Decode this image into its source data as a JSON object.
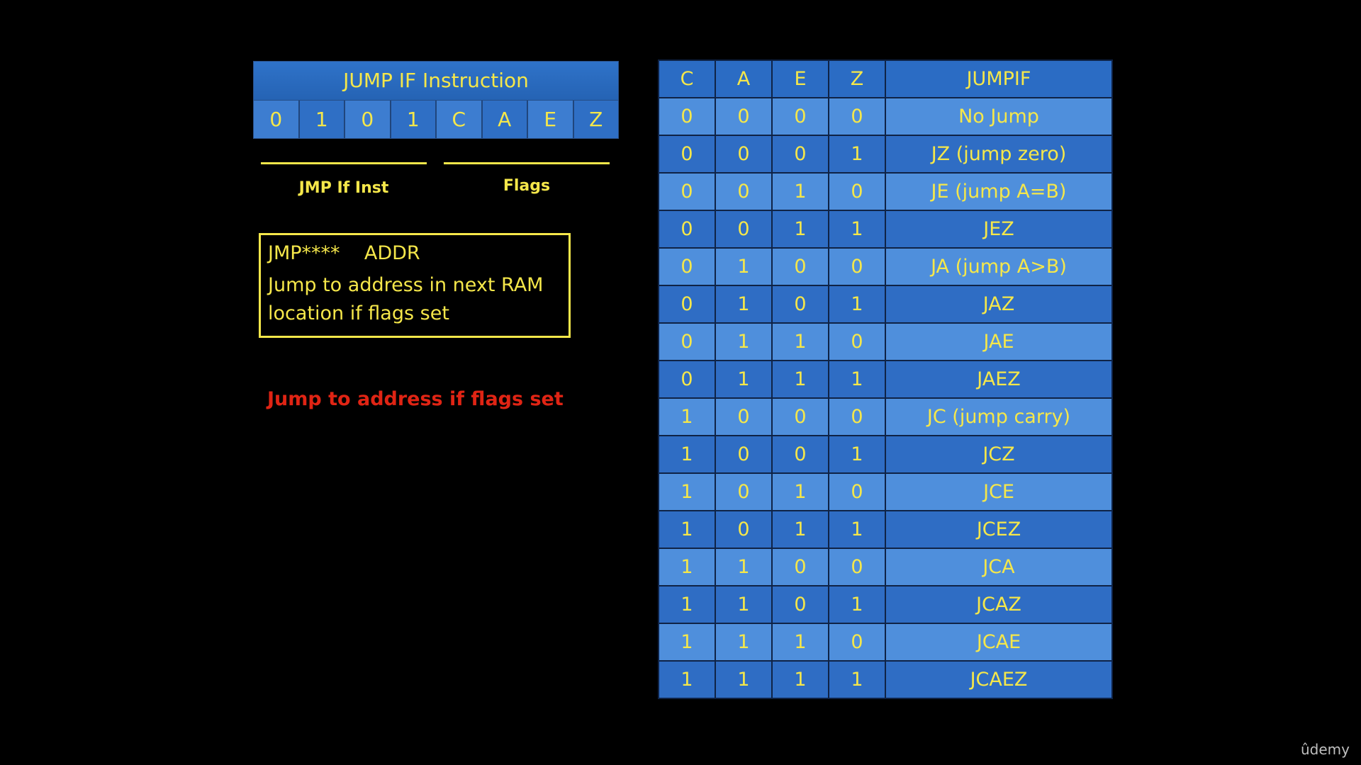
{
  "instruction": {
    "header": "JUMP  IF Instruction",
    "bits": [
      "0",
      "1",
      "0",
      "1",
      "C",
      "A",
      "E",
      "Z"
    ],
    "left_label": "JMP If Inst",
    "right_label": "Flags"
  },
  "syntax": {
    "line1": "JMP****    ADDR",
    "line2": "Jump  to address in next RAM",
    "line3": "location if flags set"
  },
  "note": "Jump  to address if flags set",
  "table": {
    "headers": [
      "C",
      "A",
      "E",
      "Z",
      "JUMPIF"
    ],
    "rows": [
      [
        "0",
        "0",
        "0",
        "0",
        "No Jump"
      ],
      [
        "0",
        "0",
        "0",
        "1",
        "JZ (jump zero)"
      ],
      [
        "0",
        "0",
        "1",
        "0",
        "JE (jump A=B)"
      ],
      [
        "0",
        "0",
        "1",
        "1",
        "JEZ"
      ],
      [
        "0",
        "1",
        "0",
        "0",
        "JA (jump A>B)"
      ],
      [
        "0",
        "1",
        "0",
        "1",
        "JAZ"
      ],
      [
        "0",
        "1",
        "1",
        "0",
        "JAE"
      ],
      [
        "0",
        "1",
        "1",
        "1",
        "JAEZ"
      ],
      [
        "1",
        "0",
        "0",
        "0",
        "JC (jump carry)"
      ],
      [
        "1",
        "0",
        "0",
        "1",
        "JCZ"
      ],
      [
        "1",
        "0",
        "1",
        "0",
        "JCE"
      ],
      [
        "1",
        "0",
        "1",
        "1",
        "JCEZ"
      ],
      [
        "1",
        "1",
        "0",
        "0",
        "JCA"
      ],
      [
        "1",
        "1",
        "0",
        "1",
        "JCAZ"
      ],
      [
        "1",
        "1",
        "1",
        "0",
        "JCAE"
      ],
      [
        "1",
        "1",
        "1",
        "1",
        "JCAEZ"
      ]
    ]
  },
  "brand": "ûdemy",
  "colors": {
    "background": "#000000",
    "text_yellow": "#f5e74a",
    "note_red": "#e02414",
    "cell_blue_light": "#4f8fdc",
    "cell_blue_dark": "#2f6dc4"
  }
}
